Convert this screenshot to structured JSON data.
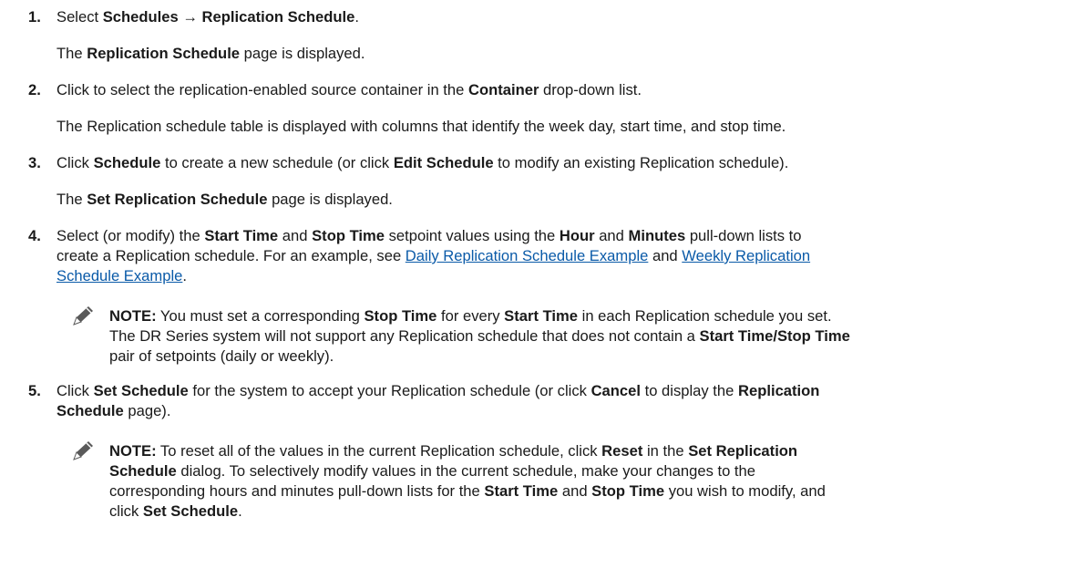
{
  "steps": [
    {
      "number": "1.",
      "lines": [
        [
          {
            "t": "Select "
          },
          {
            "t": "Schedules → Replication Schedule",
            "b": true
          },
          {
            "t": "."
          }
        ]
      ],
      "result": [
        [
          {
            "t": "The "
          },
          {
            "t": "Replication Schedule",
            "b": true
          },
          {
            "t": " page is displayed."
          }
        ]
      ]
    },
    {
      "number": "2.",
      "lines": [
        [
          {
            "t": "Click to select the replication-enabled source container in the "
          },
          {
            "t": "Container",
            "b": true
          },
          {
            "t": " drop-down list."
          }
        ]
      ],
      "result": [
        [
          {
            "t": "The Replication schedule table is displayed with columns that identify the week day, start time, and stop time."
          }
        ]
      ]
    },
    {
      "number": "3.",
      "lines": [
        [
          {
            "t": "Click "
          },
          {
            "t": "Schedule",
            "b": true
          },
          {
            "t": " to create a new schedule (or click "
          },
          {
            "t": "Edit Schedule",
            "b": true
          },
          {
            "t": " to modify an existing Replication schedule)."
          }
        ]
      ],
      "result": [
        [
          {
            "t": "The "
          },
          {
            "t": "Set Replication Schedule",
            "b": true
          },
          {
            "t": " page is displayed."
          }
        ]
      ]
    },
    {
      "number": "4.",
      "lines": [
        [
          {
            "t": "Select (or modify) the "
          },
          {
            "t": "Start Time",
            "b": true
          },
          {
            "t": " and "
          },
          {
            "t": "Stop Time",
            "b": true
          },
          {
            "t": " setpoint values using the "
          },
          {
            "t": "Hour",
            "b": true
          },
          {
            "t": " and "
          },
          {
            "t": "Minutes",
            "b": true
          },
          {
            "t": " pull-down lists to"
          }
        ],
        [
          {
            "t": "create a Replication schedule. For an example, see "
          },
          {
            "t": "Daily Replication Schedule Example",
            "link": true
          },
          {
            "t": " and "
          },
          {
            "t": "Weekly Replication",
            "link": true
          }
        ],
        [
          {
            "t": "Schedule Example",
            "link": true
          },
          {
            "t": "."
          }
        ]
      ],
      "note": [
        [
          {
            "t": "NOTE:",
            "b": true
          },
          {
            "t": " You must set a corresponding "
          },
          {
            "t": "Stop Time",
            "b": true
          },
          {
            "t": " for every "
          },
          {
            "t": "Start Time",
            "b": true
          },
          {
            "t": " in each Replication schedule you set."
          }
        ],
        [
          {
            "t": "The DR Series system will not support any Replication schedule that does not contain a "
          },
          {
            "t": "Start Time/Stop Time",
            "b": true
          }
        ],
        [
          {
            "t": "pair of setpoints (daily or weekly)."
          }
        ]
      ]
    },
    {
      "number": "5.",
      "lines": [
        [
          {
            "t": "Click "
          },
          {
            "t": "Set Schedule",
            "b": true
          },
          {
            "t": " for the system to accept your Replication schedule (or click "
          },
          {
            "t": "Cancel",
            "b": true
          },
          {
            "t": " to display the "
          },
          {
            "t": "Replication",
            "b": true
          }
        ],
        [
          {
            "t": "Schedule",
            "b": true
          },
          {
            "t": " page)."
          }
        ]
      ],
      "note": [
        [
          {
            "t": "NOTE:",
            "b": true
          },
          {
            "t": " To reset all of the values in the current Replication schedule, click "
          },
          {
            "t": "Reset",
            "b": true
          },
          {
            "t": " in the "
          },
          {
            "t": "Set Replication",
            "b": true
          }
        ],
        [
          {
            "t": "Schedule",
            "b": true
          },
          {
            "t": " dialog. To selectively modify values in the current schedule, make your changes to the"
          }
        ],
        [
          {
            "t": "corresponding hours and minutes pull-down lists for the "
          },
          {
            "t": "Start Time",
            "b": true
          },
          {
            "t": " and "
          },
          {
            "t": "Stop Time",
            "b": true
          },
          {
            "t": " you wish to modify, and"
          }
        ],
        [
          {
            "t": "click "
          },
          {
            "t": "Set Schedule",
            "b": true
          },
          {
            "t": "."
          }
        ]
      ]
    }
  ],
  "note_icon": "pencil-note-icon"
}
